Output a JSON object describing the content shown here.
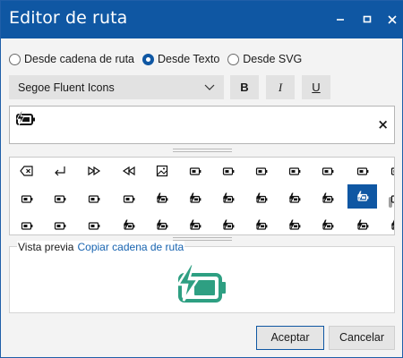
{
  "window": {
    "title": "Editor de ruta"
  },
  "titlebar": {
    "minimize_icon": "minimize-icon",
    "maximize_icon": "maximize-icon",
    "close_icon": "close-icon"
  },
  "source_options": [
    {
      "label": "Desde cadena de ruta",
      "selected": false
    },
    {
      "label": "Desde Texto",
      "selected": true
    },
    {
      "label": "Desde SVG",
      "selected": false
    }
  ],
  "font": {
    "value": "Segoe Fluent Icons"
  },
  "format": {
    "bold": "B",
    "italic": "I",
    "underline": "U"
  },
  "text_input": {
    "glyph": "battery-charging-icon",
    "clear": "×"
  },
  "glyph_grid": {
    "rows": [
      [
        "backspace",
        "return",
        "fast-forward",
        "rewind",
        "image",
        "battery",
        "battery",
        "battery",
        "battery",
        "battery",
        "battery",
        "battery"
      ],
      [
        "battery",
        "battery",
        "battery",
        "battery",
        "battery-charging",
        "battery-charging",
        "battery-charging",
        "battery-charging",
        "battery-charging",
        "battery-charging",
        "battery-charging-selected",
        "battery-saver"
      ],
      [
        "battery",
        "battery",
        "battery",
        "battery-charging",
        "battery-charging",
        "battery-charging",
        "battery-charging",
        "battery-charging",
        "battery-charging",
        "battery-charging",
        "battery-charging",
        "battery-charging"
      ]
    ],
    "selected_index": [
      1,
      10
    ]
  },
  "preview": {
    "label": "Vista previa",
    "copy_link": "Copiar cadena de ruta",
    "accent": "#2e9f82"
  },
  "buttons": {
    "ok": "Aceptar",
    "cancel": "Cancelar"
  },
  "colors": {
    "titlebar": "#0f57a3",
    "accent": "#0f57a3",
    "link": "#1763b0"
  }
}
